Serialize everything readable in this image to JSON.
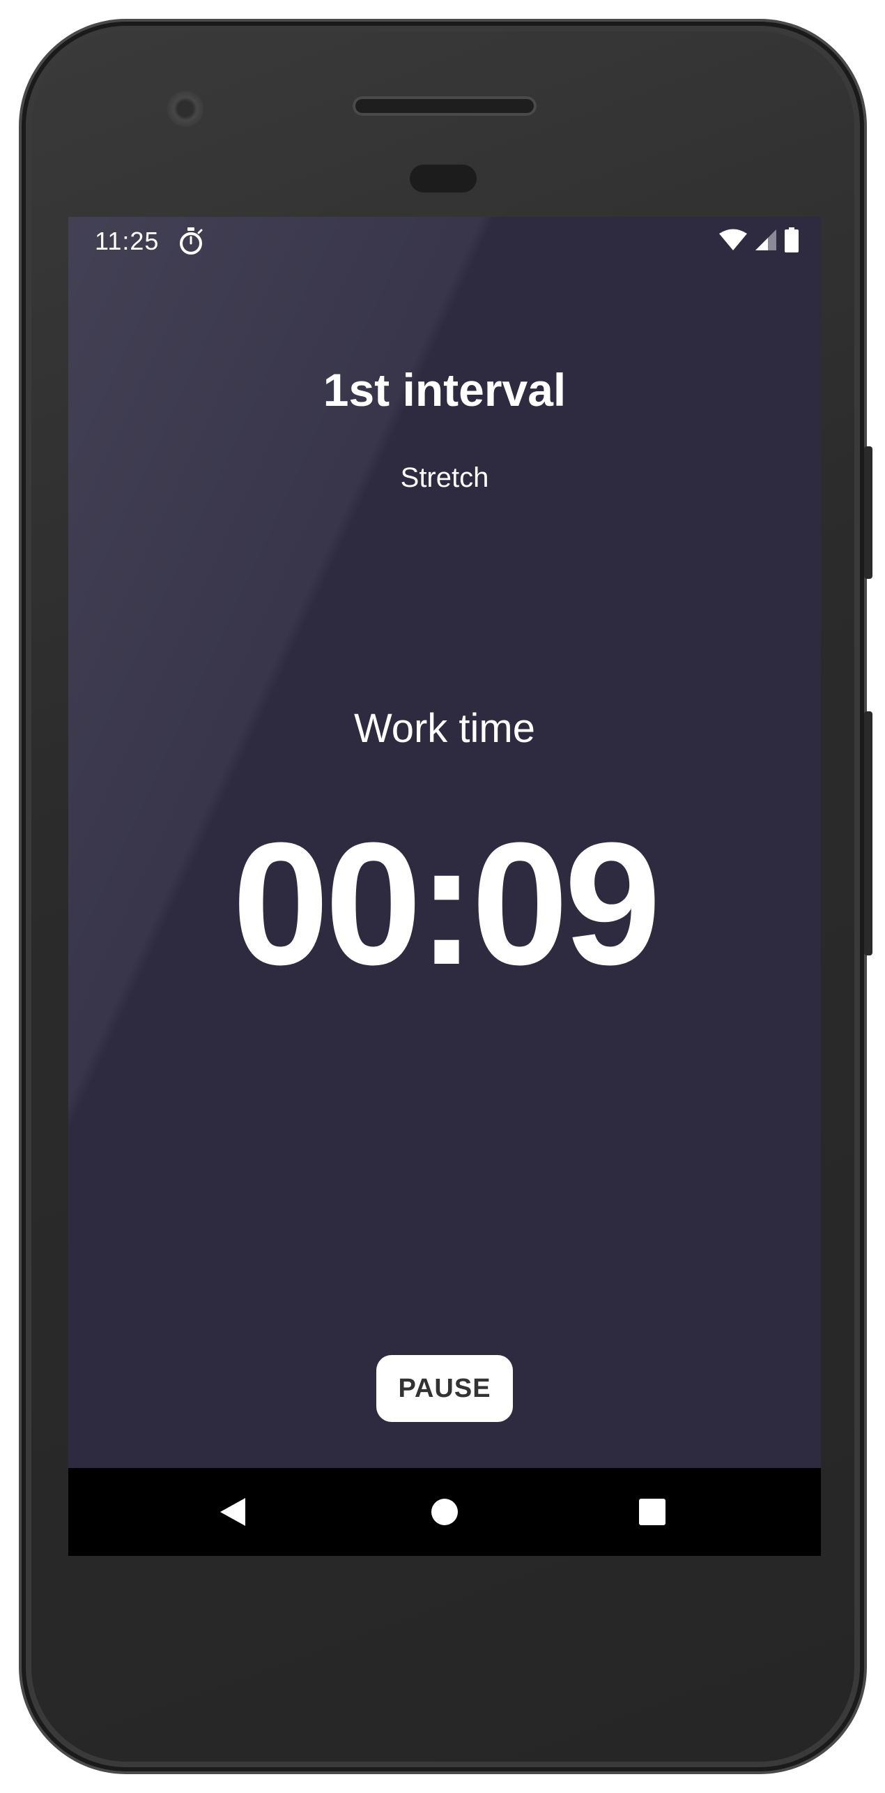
{
  "status_bar": {
    "time": "11:25"
  },
  "workout": {
    "interval_title": "1st interval",
    "exercise_name": "Stretch",
    "phase_label": "Work time",
    "countdown": "00:09"
  },
  "controls": {
    "pause_label": "PAUSE"
  },
  "colors": {
    "background": "#2e2b41",
    "button_bg": "#ffffff",
    "button_text": "#333333",
    "nav_bar": "#000000"
  },
  "icons": {
    "status_left": "stopwatch-icon",
    "status_right": [
      "wifi-icon",
      "signal-icon",
      "battery-icon"
    ],
    "nav": [
      "back-icon",
      "home-icon",
      "recents-icon"
    ]
  }
}
